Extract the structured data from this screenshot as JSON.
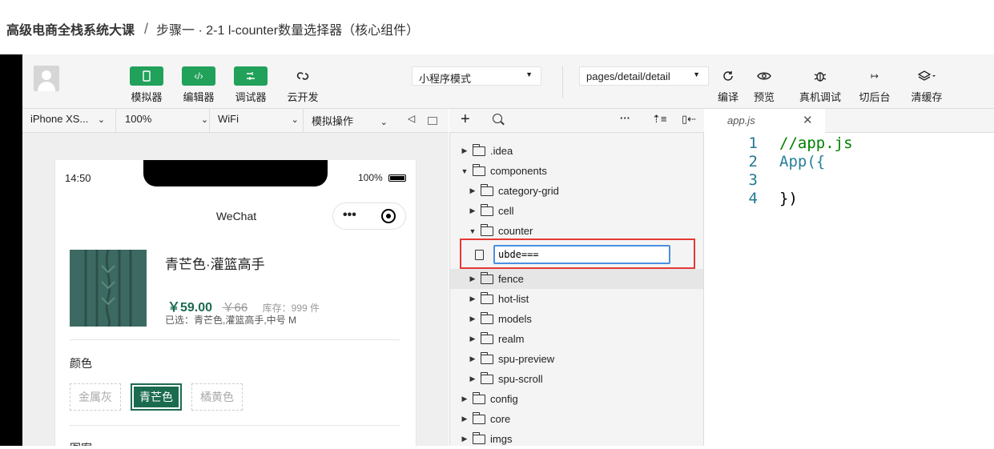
{
  "breadcrumb": {
    "course": "高级电商全栈系统大课",
    "separator": "/",
    "lesson": "步骤一 · 2-1 l-counter数量选择器（核心组件）"
  },
  "toolbar": {
    "buttons": [
      {
        "icon": "phone-icon",
        "label": "模拟器"
      },
      {
        "icon": "code-icon",
        "label": "编辑器"
      },
      {
        "icon": "debug-icon",
        "label": "调试器"
      },
      {
        "icon": "cloud-icon",
        "label": "云开发"
      }
    ],
    "mode_select": "小程序模式",
    "page_select": "pages/detail/detail",
    "right_buttons": [
      {
        "icon": "refresh-icon",
        "label": "编译"
      },
      {
        "icon": "eye-icon",
        "label": "预览"
      },
      {
        "icon": "bug-icon",
        "label": "真机调试"
      },
      {
        "icon": "switch-backend-icon",
        "label": "切后台"
      },
      {
        "icon": "layers-icon",
        "label": "清缓存"
      }
    ]
  },
  "subbar": {
    "device": "iPhone XS...",
    "zoom": "100%",
    "network": "WiFi",
    "operation": "模拟操作"
  },
  "phone": {
    "time": "14:50",
    "battery": "100%",
    "nav_title": "WeChat",
    "product_title": "青芒色·灌篮高手",
    "price": "￥59.00",
    "original_price": "￥66",
    "stock": "库存：999 件",
    "selected": "已选：青芒色,灌篮高手,中号 M",
    "color_label": "颜色",
    "colors": [
      "金属灰",
      "青芒色",
      "橘黄色"
    ],
    "pattern_label": "图案"
  },
  "tree": {
    "items": [
      {
        "name": ".idea",
        "level": 0,
        "expanded": false
      },
      {
        "name": "components",
        "level": 0,
        "expanded": true
      },
      {
        "name": "category-grid",
        "level": 1,
        "expanded": false
      },
      {
        "name": "cell",
        "level": 1,
        "expanded": false
      },
      {
        "name": "counter",
        "level": 1,
        "expanded": true
      },
      {
        "name": "fence",
        "level": 1,
        "expanded": false
      },
      {
        "name": "hot-list",
        "level": 1,
        "expanded": false
      },
      {
        "name": "models",
        "level": 1,
        "expanded": false
      },
      {
        "name": "realm",
        "level": 1,
        "expanded": false
      },
      {
        "name": "spu-preview",
        "level": 1,
        "expanded": false
      },
      {
        "name": "spu-scroll",
        "level": 1,
        "expanded": false
      },
      {
        "name": "config",
        "level": 0,
        "expanded": false
      },
      {
        "name": "core",
        "level": 0,
        "expanded": false
      },
      {
        "name": "imgs",
        "level": 0,
        "expanded": false
      }
    ],
    "new_file_value": "ubde===",
    "accent": "#e53935"
  },
  "editor": {
    "tab": "app.js",
    "lines": [
      {
        "no": "1",
        "text": "//app.js"
      },
      {
        "no": "2",
        "text": "App({"
      },
      {
        "no": "3",
        "text": ""
      },
      {
        "no": "4",
        "text": "})"
      }
    ]
  },
  "colors": {
    "green": "#21a15a",
    "dark_green": "#1b6b4f",
    "price": "#1b6b4f",
    "highlight": "#e53935"
  }
}
